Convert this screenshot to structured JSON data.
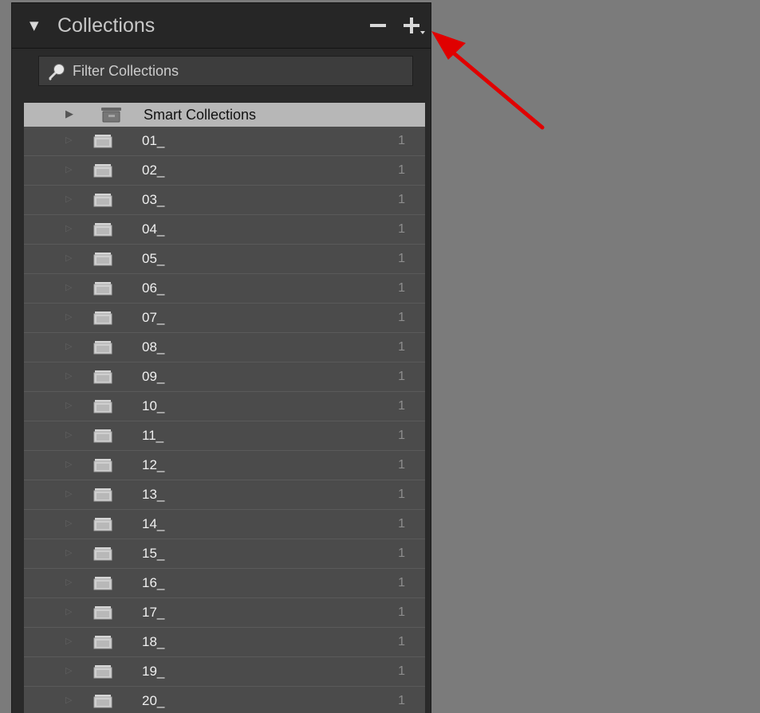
{
  "panel": {
    "title": "Collections",
    "filter_placeholder": "Filter Collections",
    "smart_collection_label": "Smart Collections"
  },
  "collections": [
    {
      "label": "01_",
      "count": "1"
    },
    {
      "label": "02_",
      "count": "1"
    },
    {
      "label": "03_",
      "count": "1"
    },
    {
      "label": "04_",
      "count": "1"
    },
    {
      "label": "05_",
      "count": "1"
    },
    {
      "label": "06_",
      "count": "1"
    },
    {
      "label": "07_",
      "count": "1"
    },
    {
      "label": "08_",
      "count": "1"
    },
    {
      "label": "09_",
      "count": "1"
    },
    {
      "label": "10_",
      "count": "1"
    },
    {
      "label": "11_",
      "count": "1"
    },
    {
      "label": "12_",
      "count": "1"
    },
    {
      "label": "13_",
      "count": "1"
    },
    {
      "label": "14_",
      "count": "1"
    },
    {
      "label": "15_",
      "count": "1"
    },
    {
      "label": "16_",
      "count": "1"
    },
    {
      "label": "17_",
      "count": "1"
    },
    {
      "label": "18_",
      "count": "1"
    },
    {
      "label": "19_",
      "count": "1"
    },
    {
      "label": "20_",
      "count": "1"
    }
  ],
  "icons": {
    "panel_toggle": "collapse-triangle-icon",
    "remove": "minus-icon",
    "add": "plus-icon",
    "search": "search-icon",
    "smart_toggle": "expand-triangle-icon",
    "smart_folder": "smart-collection-icon",
    "collection": "collection-icon",
    "annotation": "annotation-arrow-icon"
  },
  "colors": {
    "workspace": "#7b7b7b",
    "panel_background": "#2a2a2a",
    "list_background": "#4b4b4b",
    "selected_row": "#b7b7b7",
    "annotation": "#e00000"
  }
}
